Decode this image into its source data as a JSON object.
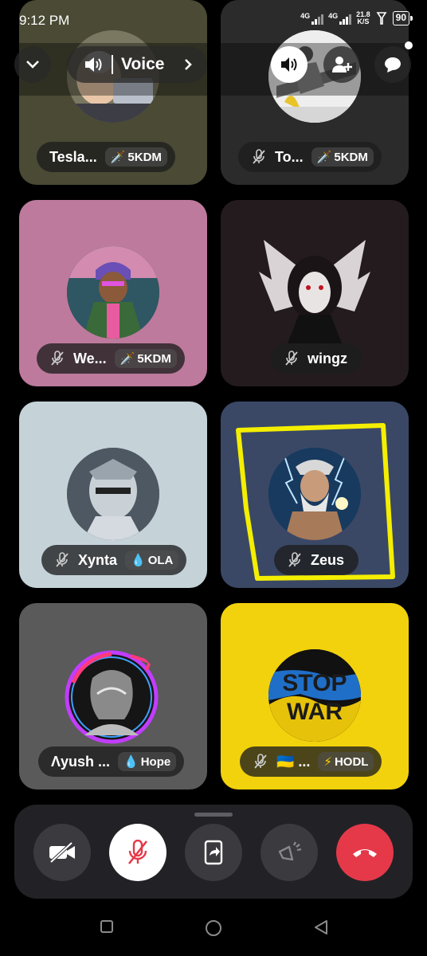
{
  "status_bar": {
    "time": "9:12 PM",
    "network_1": "4G",
    "network_2": "4G",
    "speed_value": "21.8",
    "speed_unit": "K/S",
    "battery": "90"
  },
  "header": {
    "channel_label": "Voice",
    "icons": [
      "chevron-down-icon",
      "speaker-icon",
      "chevron-right-icon",
      "volume-icon",
      "add-user-icon",
      "chat-bubble-icon"
    ]
  },
  "participants": [
    {
      "name": "Tesla...",
      "muted": false,
      "badge": "5KDM",
      "badge_icon": "sword-icon",
      "bg": "#4a4a35"
    },
    {
      "name": "To...",
      "muted": true,
      "badge": "5KDM",
      "badge_icon": "sword-icon",
      "bg": "#2b2b2b"
    },
    {
      "name": "We...",
      "muted": true,
      "badge": "5KDM",
      "badge_icon": "sword-icon",
      "bg": "#bd7a9c"
    },
    {
      "name": "wingz",
      "muted": true,
      "badge": "",
      "bg": "#231b1d"
    },
    {
      "name": "Xynta",
      "muted": true,
      "badge": "OLA",
      "badge_icon": "diamond-icon",
      "bg": "#c5d3d9"
    },
    {
      "name": "Zeus",
      "muted": true,
      "badge": "",
      "bg": "#3a4866",
      "highlighted": true
    },
    {
      "name": "Λyush ...",
      "muted": false,
      "badge": "Hope",
      "badge_icon": "diamond-icon",
      "bg": "#5a5a5a"
    },
    {
      "name": "🇺🇦 ...",
      "muted": true,
      "badge": "HODL",
      "badge_icon": "lightning-icon",
      "bg": "#f2d20c"
    }
  ],
  "avatar_text": {
    "stop": "STOP",
    "war": "WAR"
  },
  "controls": [
    {
      "id": "camera-off-button",
      "icon": "camera-off-icon",
      "bg": "#3a3a3f"
    },
    {
      "id": "mute-toggle-button",
      "icon": "mic-off-icon",
      "bg": "#ffffff"
    },
    {
      "id": "screen-share-button",
      "icon": "screen-share-icon",
      "bg": "#3a3a3f"
    },
    {
      "id": "soundboard-button",
      "icon": "sparkle-speaker-icon",
      "bg": "#3a3a3f"
    },
    {
      "id": "leave-call-button",
      "icon": "hang-up-icon",
      "bg": "#e5394a"
    }
  ],
  "colors": {
    "highlight_outline": "#f4ee00",
    "hangup_red": "#e5394a",
    "panel_bg": "#222226"
  }
}
